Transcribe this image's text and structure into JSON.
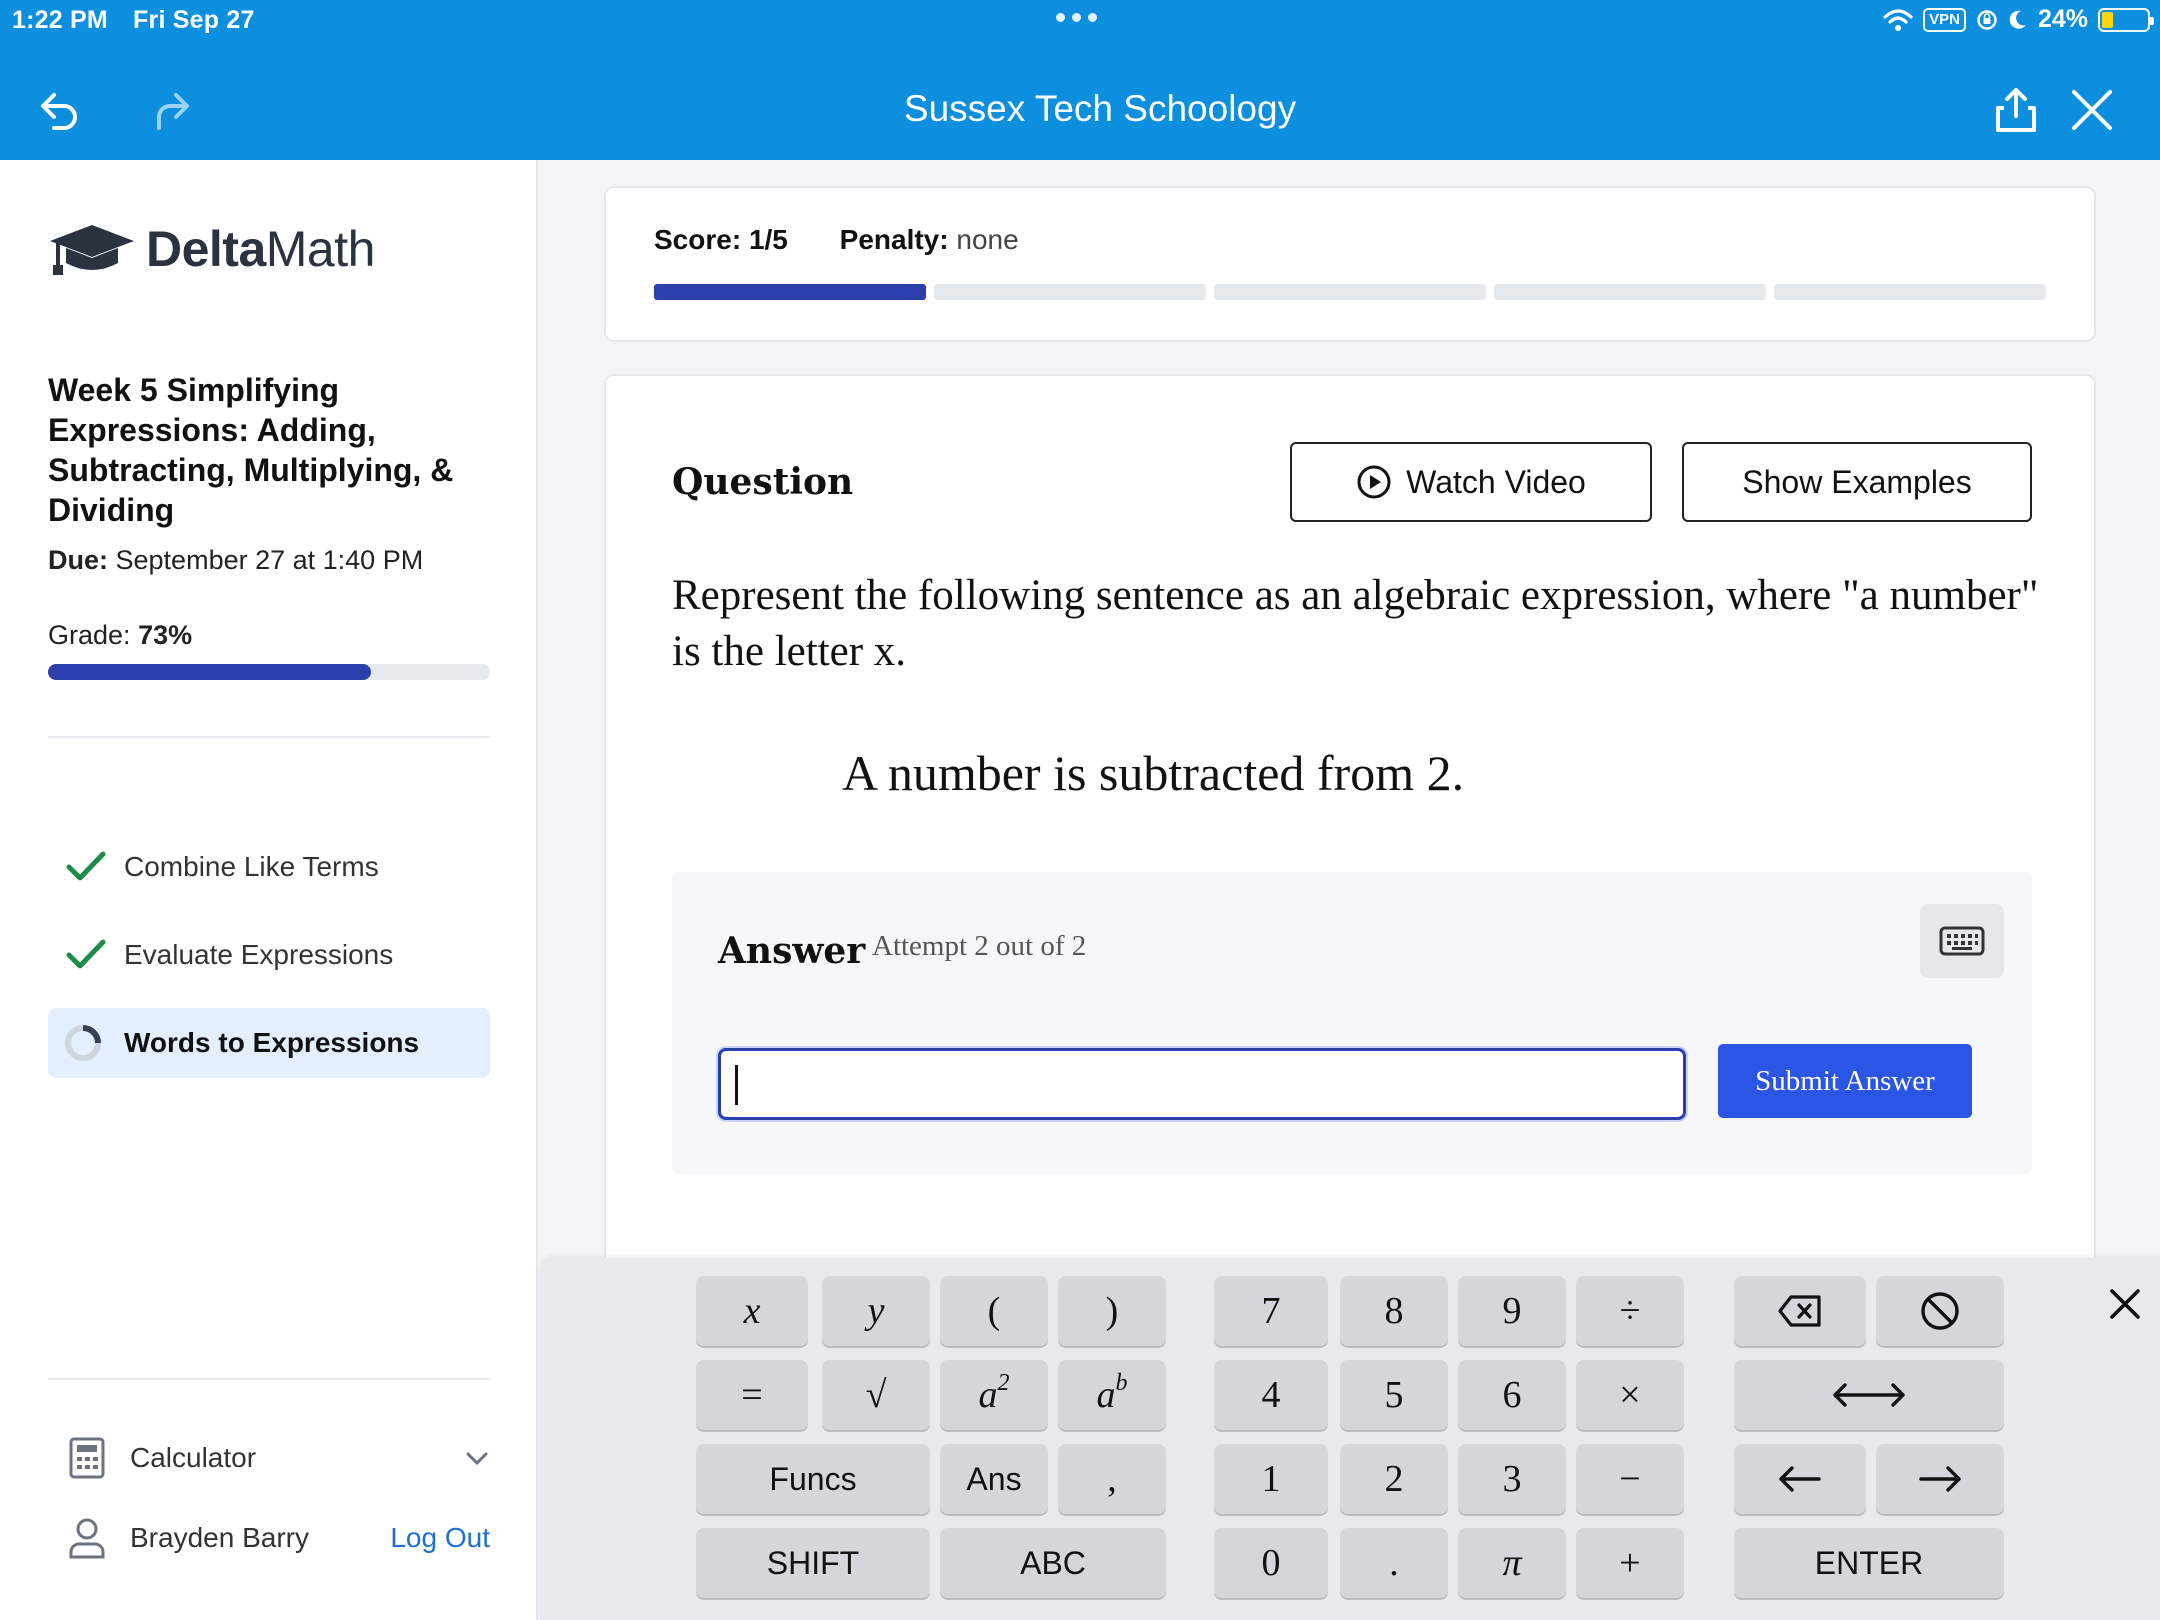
{
  "status_bar": {
    "time": "1:22 PM",
    "date": "Fri Sep 27",
    "vpn": "VPN",
    "battery": "24%",
    "battery_level": 0.24
  },
  "header": {
    "title": "Sussex Tech Schoology"
  },
  "sidebar": {
    "logo_bold": "Delta",
    "logo_light": "Math",
    "assignment_title": "Week 5 Simplifying Expressions: Adding, Subtracting, Multiplying, & Dividing",
    "due_label": "Due:",
    "due_value": "September 27 at 1:40 PM",
    "grade_label": "Grade:",
    "grade_value": "73%",
    "grade_fraction": 0.73,
    "skills": [
      {
        "label": "Combine Like Terms",
        "status": "complete"
      },
      {
        "label": "Evaluate Expressions",
        "status": "complete"
      },
      {
        "label": "Words to Expressions",
        "status": "in-progress"
      }
    ],
    "calculator_label": "Calculator",
    "user_name": "Brayden Barry",
    "logout_label": "Log Out"
  },
  "score": {
    "score_label": "Score:",
    "score_value": "1/5",
    "penalty_label": "Penalty:",
    "penalty_value": "none",
    "completed": 1,
    "total": 5
  },
  "question": {
    "heading": "Question",
    "watch_video": "Watch Video",
    "show_examples": "Show Examples",
    "prompt": "Represent the following sentence as an algebraic expression, where \"a number\" is the letter x.",
    "sentence": "A number is subtracted from 2.",
    "answer_label": "Answer",
    "attempt_text": "Attempt 2 out of 2",
    "answer_value": "",
    "submit_label": "Submit Answer"
  },
  "keypad": {
    "row1": [
      "x",
      "y",
      "(",
      ")",
      "7",
      "8",
      "9",
      "÷"
    ],
    "row2": [
      "=",
      "√",
      "a",
      "2",
      "a",
      "b",
      "4",
      "5",
      "6",
      "×"
    ],
    "row3": [
      "Funcs",
      "Ans",
      ",",
      "1",
      "2",
      "3",
      "−",
      "←",
      "→"
    ],
    "row4": [
      "SHIFT",
      "ABC",
      "0",
      ".",
      "π",
      "+",
      "ENTER"
    ]
  },
  "colors": {
    "header_bg": "#0b8fde",
    "progress_fill": "#2b3eac",
    "submit_bg": "#2a55e5",
    "check_green": "#1e8a4c",
    "active_skill_bg": "#e3efff"
  }
}
